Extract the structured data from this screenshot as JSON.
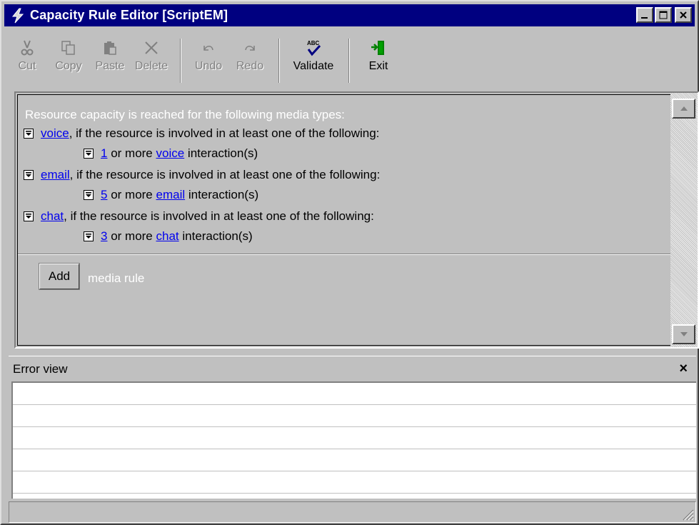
{
  "window": {
    "title": "Capacity Rule Editor [ScriptEM]",
    "controls": [
      "minimize",
      "maximize",
      "close"
    ]
  },
  "toolbar": {
    "cut": "Cut",
    "copy": "Copy",
    "paste": "Paste",
    "delete": "Delete",
    "undo": "Undo",
    "redo": "Redo",
    "validate": "Validate",
    "exit": "Exit"
  },
  "editor": {
    "intro": "Resource capacity is reached for the following media types:",
    "rules": [
      {
        "media": "voice",
        "condition": ", if the resource is involved in at least one of the following:",
        "count": "1",
        "or_more": " or more ",
        "media2": "voice",
        "suffix": " interaction(s)"
      },
      {
        "media": "email",
        "condition": ", if the resource is involved in at least one of the following:",
        "count": "5",
        "or_more": " or more ",
        "media2": "email",
        "suffix": " interaction(s)"
      },
      {
        "media": "chat",
        "condition": ", if the resource is involved in at least one of the following:",
        "count": "3",
        "or_more": " or more ",
        "media2": "chat",
        "suffix": " interaction(s)"
      }
    ],
    "add_button": "Add",
    "add_tail": "media rule"
  },
  "error_view": {
    "title": "Error view",
    "close": "×"
  },
  "colors": {
    "titlebar": "#000080",
    "face": "#c0c0c0",
    "link": "#0000ee"
  }
}
